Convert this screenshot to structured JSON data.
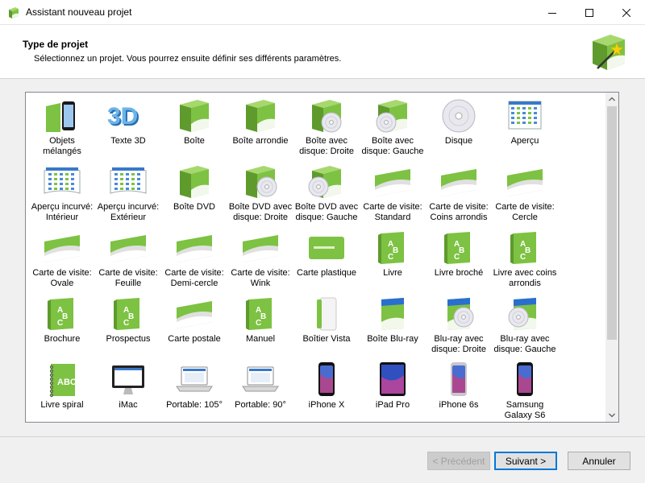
{
  "window": {
    "title": "Assistant nouveau projet",
    "minimize_icon": "minimize-icon",
    "maximize_icon": "maximize-icon",
    "close_icon": "close-icon"
  },
  "header": {
    "title": "Type de projet",
    "subtitle": "Sélectionnez un projet. Vous pourrez ensuite définir ses différents paramètres.",
    "icon": "wizard-wand-icon"
  },
  "colors": {
    "accent_green": "#7dc242",
    "focus_blue": "#0078d7"
  },
  "projects": [
    {
      "label": "Objets mélangés",
      "icon": "mixed-objects-icon"
    },
    {
      "label": "Texte 3D",
      "icon": "text-3d-icon"
    },
    {
      "label": "Boîte",
      "icon": "box-icon"
    },
    {
      "label": "Boîte arrondie",
      "icon": "rounded-box-icon"
    },
    {
      "label": "Boîte avec disque: Droite",
      "icon": "box-disc-right-icon"
    },
    {
      "label": "Boîte avec disque: Gauche",
      "icon": "box-disc-left-icon"
    },
    {
      "label": "Disque",
      "icon": "disc-icon"
    },
    {
      "label": "Aperçu",
      "icon": "preview-icon"
    },
    {
      "label": "Aperçu incurvé: Intérieur",
      "icon": "curved-preview-inner-icon"
    },
    {
      "label": "Aperçu incurvé: Extérieur",
      "icon": "curved-preview-outer-icon"
    },
    {
      "label": "Boîte DVD",
      "icon": "dvd-box-icon"
    },
    {
      "label": "Boîte DVD avec disque: Droite",
      "icon": "dvd-box-disc-right-icon"
    },
    {
      "label": "Boîte DVD avec disque: Gauche",
      "icon": "dvd-box-disc-left-icon"
    },
    {
      "label": "Carte de visite: Standard",
      "icon": "business-card-standard-icon"
    },
    {
      "label": "Carte de visite: Coins arrondis",
      "icon": "business-card-rounded-icon"
    },
    {
      "label": "Carte de visite: Cercle",
      "icon": "business-card-circle-icon"
    },
    {
      "label": "Carte de visite: Ovale",
      "icon": "business-card-oval-icon"
    },
    {
      "label": "Carte de visite: Feuille",
      "icon": "business-card-leaf-icon"
    },
    {
      "label": "Carte de visite: Demi-cercle",
      "icon": "business-card-half-circle-icon"
    },
    {
      "label": "Carte de visite: Wink",
      "icon": "business-card-wink-icon"
    },
    {
      "label": "Carte plastique",
      "icon": "plastic-card-icon"
    },
    {
      "label": "Livre",
      "icon": "book-icon"
    },
    {
      "label": "Livre broché",
      "icon": "paperback-book-icon"
    },
    {
      "label": "Livre avec coins arrondis",
      "icon": "rounded-book-icon"
    },
    {
      "label": "Brochure",
      "icon": "brochure-icon"
    },
    {
      "label": "Prospectus",
      "icon": "flyer-icon"
    },
    {
      "label": "Carte postale",
      "icon": "postcard-icon"
    },
    {
      "label": "Manuel",
      "icon": "manual-icon"
    },
    {
      "label": "Boîtier Vista",
      "icon": "vista-case-icon"
    },
    {
      "label": "Boîte Blu-ray",
      "icon": "bluray-box-icon"
    },
    {
      "label": "Blu-ray avec disque: Droite",
      "icon": "bluray-disc-right-icon"
    },
    {
      "label": "Blu-ray avec disque: Gauche",
      "icon": "bluray-disc-left-icon"
    },
    {
      "label": "Livre spiral",
      "icon": "spiral-book-icon"
    },
    {
      "label": "iMac",
      "icon": "imac-icon"
    },
    {
      "label": "Portable: 105°",
      "icon": "laptop-105-icon"
    },
    {
      "label": "Portable: 90°",
      "icon": "laptop-90-icon"
    },
    {
      "label": "iPhone X",
      "icon": "iphone-x-icon"
    },
    {
      "label": "iPad Pro",
      "icon": "ipad-pro-icon"
    },
    {
      "label": "iPhone 6s",
      "icon": "iphone-6s-icon"
    },
    {
      "label": "Samsung Galaxy S6",
      "icon": "galaxy-s6-icon"
    }
  ],
  "buttons": {
    "previous": "< Précédent",
    "next": "Suivant >",
    "cancel": "Annuler"
  }
}
